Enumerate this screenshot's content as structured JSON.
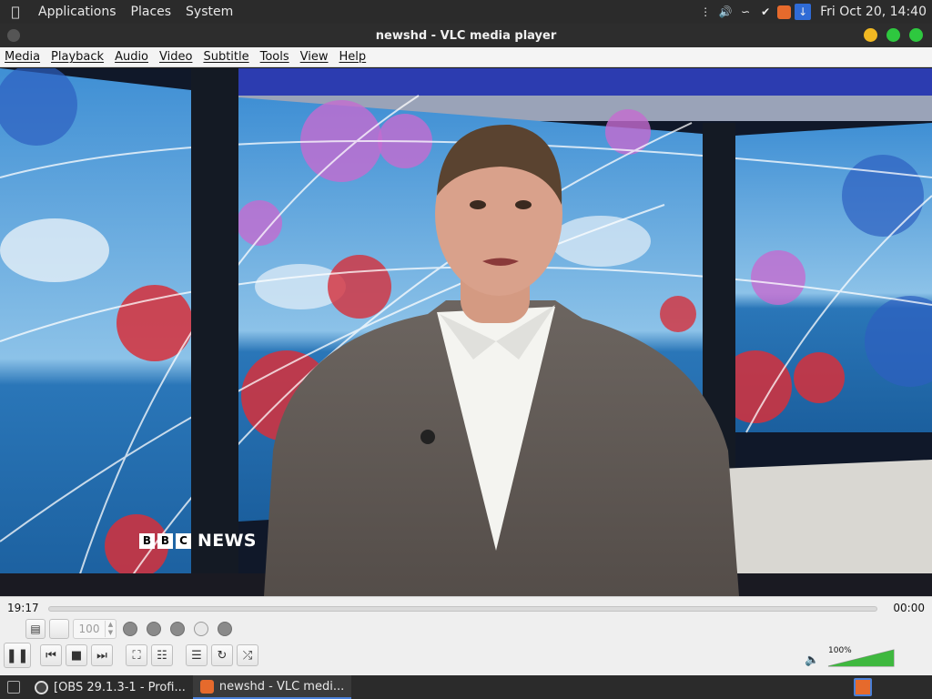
{
  "topbar": {
    "menus": [
      "Applications",
      "Places",
      "System"
    ],
    "clock": "Fri Oct 20, 14:40"
  },
  "window": {
    "title": "newshd - VLC media player"
  },
  "menubar": {
    "items": [
      "Media",
      "Playback",
      "Audio",
      "Video",
      "Subtitle",
      "Tools",
      "View",
      "Help"
    ]
  },
  "video": {
    "channel_logo": [
      "B",
      "B",
      "C"
    ],
    "channel_name": "NEWS"
  },
  "controls": {
    "elapsed": "19:17",
    "remaining": "00:00",
    "spinbox_value": "100",
    "volume": "100%"
  },
  "taskbar": {
    "items": [
      "[OBS 29.1.3-1 - Profi...",
      "newshd - VLC medi..."
    ]
  },
  "colors": {
    "accent": "#4a80d8",
    "vlc_orange": "#e66a2c",
    "close": "#2ec83f",
    "maximize": "#2ec83f",
    "minimize": "#f0b822"
  }
}
